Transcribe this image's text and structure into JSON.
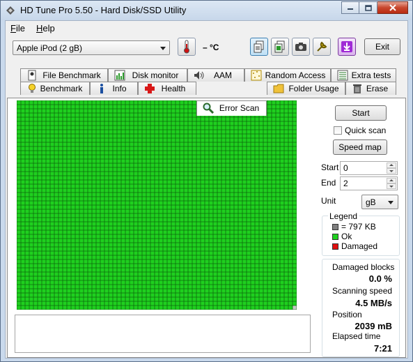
{
  "window": {
    "title": "HD Tune Pro 5.50 - Hard Disk/SSD Utility"
  },
  "menu": {
    "items": [
      {
        "label": "File",
        "accel": "F",
        "rest": "ile"
      },
      {
        "label": "Help",
        "accel": "H",
        "rest": "elp"
      }
    ]
  },
  "toolbar": {
    "drive": "Apple   iPod (2 gB)",
    "temperature": "– °C",
    "exit_label": "Exit",
    "icons": [
      "thermometer-icon",
      "copy-text-icon",
      "copy-info-icon",
      "camera-icon",
      "options-icon",
      "save-icon"
    ]
  },
  "tabs": {
    "row1": [
      "File Benchmark",
      "Disk monitor",
      "AAM",
      "Random Access",
      "Extra tests"
    ],
    "row2": [
      "Benchmark",
      "Info",
      "Health",
      "Error Scan",
      "Folder Usage",
      "Erase"
    ],
    "selected": "Error Scan"
  },
  "scan": {
    "start_button": "Start",
    "quick_scan_label": "Quick scan",
    "quick_scan_checked": false,
    "speed_map_button": "Speed map",
    "start_label": "Start",
    "start_value": "0",
    "end_label": "End",
    "end_value": "2",
    "unit_label": "Unit",
    "unit_value": "gB",
    "grid_columns": 67,
    "grid_rows": 50,
    "block_status": "ok",
    "last_block_status": "unscanned"
  },
  "legend": {
    "title": "Legend",
    "items": [
      {
        "label": "= 797 KB",
        "color": "#808080"
      },
      {
        "label": "Ok",
        "color": "#1fd01f"
      },
      {
        "label": "Damaged",
        "color": "#e01010"
      }
    ]
  },
  "stats": {
    "damaged_blocks_label": "Damaged blocks",
    "damaged_blocks_value": "0.0 %",
    "scanning_speed_label": "Scanning speed",
    "scanning_speed_value": "4.5 MB/s",
    "position_label": "Position",
    "position_value": "2039 mB",
    "elapsed_time_label": "Elapsed time",
    "elapsed_time_value": "7:21"
  },
  "colors": {
    "ok": "#1fd01f",
    "grid_line": "#0d6b0d",
    "unscanned": "#c8c8c8"
  }
}
